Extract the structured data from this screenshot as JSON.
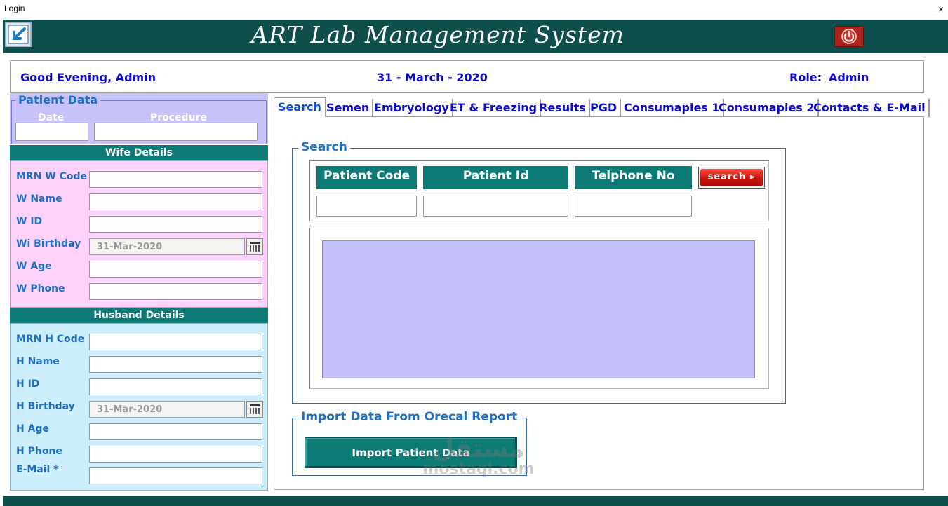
{
  "window": {
    "title": "Login",
    "close_glyph": "×"
  },
  "header": {
    "app_title": "ART Lab Management System",
    "back_icon": "arrow-back-icon",
    "power_icon": "power-icon"
  },
  "greeting": {
    "text": "Good Evening, Admin",
    "date": "31 - March - 2020",
    "role_label": "Role:",
    "role_value": "Admin"
  },
  "patient_data": {
    "legend": "Patient Data",
    "date_label": "Date",
    "procedure_label": "Procedure",
    "date_value": "",
    "procedure_value": ""
  },
  "wife": {
    "title": "Wife Details",
    "fields": [
      {
        "label": "MRN W Code",
        "value": ""
      },
      {
        "label": "W Name",
        "value": ""
      },
      {
        "label": "W ID",
        "value": ""
      },
      {
        "label": "Wi Birthday",
        "value": "31-Mar-2020"
      },
      {
        "label": "W Age",
        "value": ""
      },
      {
        "label": "W Phone",
        "value": ""
      }
    ]
  },
  "husband": {
    "title": "Husband Details",
    "fields": [
      {
        "label": "MRN H Code",
        "value": ""
      },
      {
        "label": "H Name",
        "value": ""
      },
      {
        "label": "H ID",
        "value": ""
      },
      {
        "label": "H Birthday",
        "value": "31-Mar-2020"
      },
      {
        "label": "H Age",
        "value": ""
      },
      {
        "label": "H Phone",
        "value": ""
      },
      {
        "label": "E-Mail *",
        "value": ""
      }
    ]
  },
  "tabs": [
    {
      "label": "Search"
    },
    {
      "label": "Semen"
    },
    {
      "label": "Embryology"
    },
    {
      "label": "ET & Freezing"
    },
    {
      "label": "Results"
    },
    {
      "label": "PGD"
    },
    {
      "label": "Consumaples 1"
    },
    {
      "label": "Consumaples 2"
    },
    {
      "label": "Contacts & E-Mail"
    }
  ],
  "search": {
    "legend": "Search",
    "columns": [
      "Patient Code",
      "Patient Id",
      "Telphone No"
    ],
    "button_label": "search ▸",
    "patient_code": "",
    "patient_id": "",
    "telephone": ""
  },
  "import": {
    "legend": "Import Data From Orecal Report",
    "button_label": "Import Patient Data"
  },
  "watermark": {
    "arabic": "مستقل",
    "latin": "mostaql.com"
  },
  "colors": {
    "header": "#0f4f4b",
    "teal": "#0c7b76",
    "patient_bg": "#c6c3fb",
    "wife_bg": "#fdd3fc",
    "husband_bg": "#cdeefb",
    "label_blue": "#1f6fc4",
    "greeting_blue": "#0b0bd2"
  }
}
